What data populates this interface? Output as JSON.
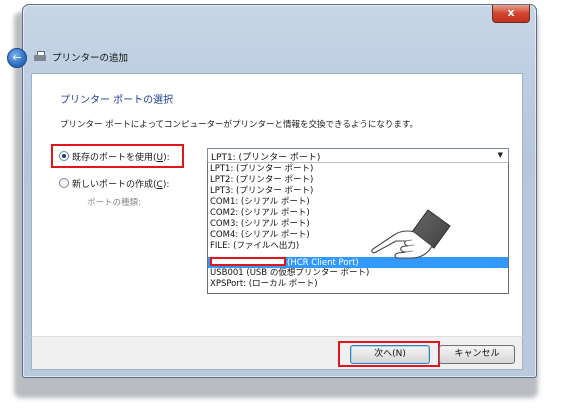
{
  "window": {
    "title": "プリンターの追加",
    "close_glyph": "x"
  },
  "page": {
    "heading": "プリンター ポートの選択",
    "description": "プリンター ポートによってコンピューターがプリンターと情報を交換できるようになります。"
  },
  "options": {
    "existing_port_prefix": "既存のポートを使用(",
    "existing_port_key": "U",
    "existing_port_suffix": "):",
    "new_port_prefix": "新しいポートの作成(",
    "new_port_key": "C",
    "new_port_suffix": "):",
    "port_type_label": "ポートの種類:"
  },
  "port_select": {
    "selected_value": "LPT1: (プリンター ポート)",
    "dropdown_glyph": "▼",
    "items": [
      "LPT1: (プリンター ポート)",
      "LPT2: (プリンター ポート)",
      "LPT3: (プリンター ポート)",
      "COM1: (シリアル ポート)",
      "COM2: (シリアル ポート)",
      "COM3: (シリアル ポート)",
      "COM4: (シリアル ポート)",
      "FILE: (ファイルへ出力)",
      "(HCR Client Port)",
      "USB001 (USB の仮想プリンター ポート)",
      "XPSPort: (ローカル ポート)"
    ],
    "highlighted_index": 8
  },
  "buttons": {
    "next": "次へ(N)",
    "cancel": "キャンセル"
  },
  "icons": {
    "back": "back-arrow-icon",
    "printer": "printer-icon",
    "close": "close-icon",
    "pointer": "pointing-hand-icon"
  },
  "colors": {
    "heading": "#1e3f9a",
    "highlight": "#e2141c",
    "selection": "#3399ff"
  }
}
